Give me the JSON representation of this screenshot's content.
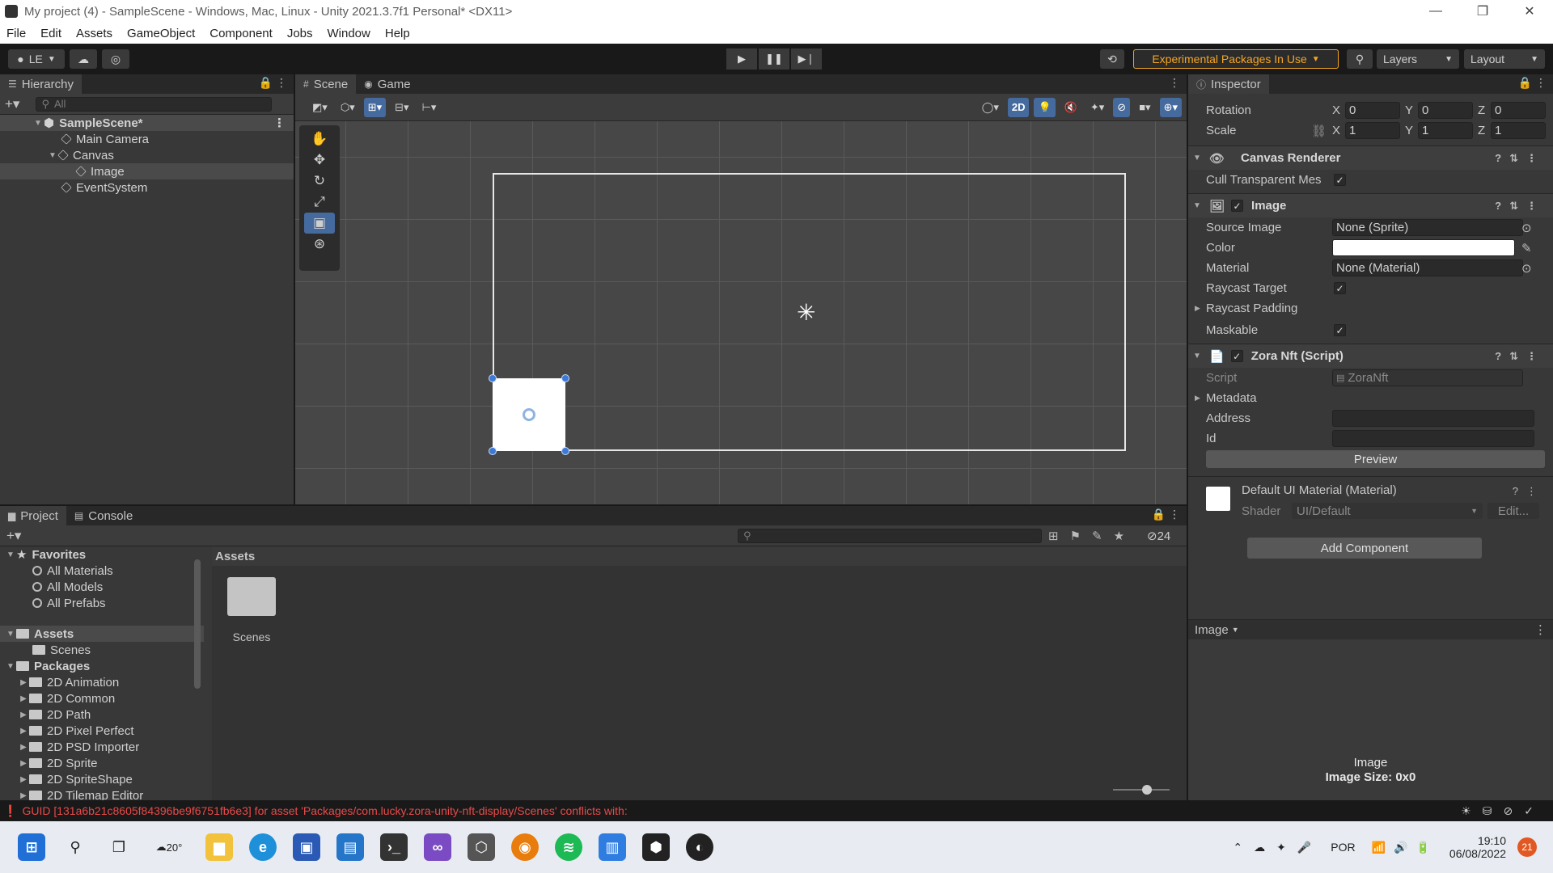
{
  "window": {
    "title": "My project (4) - SampleScene - Windows, Mac, Linux - Unity 2021.3.7f1 Personal* <DX11>",
    "minimize": "—",
    "restore": "❐",
    "close": "✕"
  },
  "menu": [
    "File",
    "Edit",
    "Assets",
    "GameObject",
    "Component",
    "Jobs",
    "Window",
    "Help"
  ],
  "toolbar": {
    "account": "LE",
    "experimental": "Experimental Packages In Use",
    "layers": "Layers",
    "layout": "Layout"
  },
  "hierarchy": {
    "tab": "Hierarchy",
    "search_placeholder": "All",
    "items": [
      "SampleScene*",
      "Main Camera",
      "Canvas",
      "Image",
      "EventSystem"
    ]
  },
  "scene": {
    "tabs": [
      "Scene",
      "Game"
    ],
    "mode_2d": "2D"
  },
  "inspector": {
    "tab": "Inspector",
    "transform": {
      "rotation_label": "Rotation",
      "scale_label": "Scale",
      "rotation": [
        "0",
        "0",
        "0"
      ],
      "scale": [
        "1",
        "1",
        "1"
      ],
      "axes": [
        "X",
        "Y",
        "Z"
      ]
    },
    "canvas_renderer": {
      "title": "Canvas Renderer",
      "cull_label": "Cull Transparent Mes"
    },
    "image": {
      "title": "Image",
      "source_image_label": "Source Image",
      "source_image": "None (Sprite)",
      "color_label": "Color",
      "material_label": "Material",
      "material": "None (Material)",
      "raycast_target_label": "Raycast Target",
      "raycast_padding_label": "Raycast Padding",
      "maskable_label": "Maskable"
    },
    "zora": {
      "title": "Zora Nft (Script)",
      "script_label": "Script",
      "script": "ZoraNft",
      "metadata_label": "Metadata",
      "address_label": "Address",
      "id_label": "Id",
      "preview_button": "Preview"
    },
    "material": {
      "title": "Default UI Material (Material)",
      "shader_label": "Shader",
      "shader": "UI/Default",
      "edit_button": "Edit..."
    },
    "add_component": "Add Component",
    "preview_header": "Image",
    "preview_name": "Image",
    "preview_size": "Image Size: 0x0"
  },
  "project": {
    "tabs": [
      "Project",
      "Console"
    ],
    "favorites_label": "Favorites",
    "favorites": [
      "All Materials",
      "All Models",
      "All Prefabs"
    ],
    "assets_label": "Assets",
    "assets_children": [
      "Scenes"
    ],
    "packages_label": "Packages",
    "packages": [
      "2D Animation",
      "2D Common",
      "2D Path",
      "2D Pixel Perfect",
      "2D PSD Importer",
      "2D Sprite",
      "2D SpriteShape",
      "2D Tilemap Editor"
    ],
    "breadcrumb": "Assets",
    "grid_items": [
      "Scenes"
    ],
    "hidden_count": "24"
  },
  "status": {
    "error": "GUID [131a6b21c8605f84396be9f6751fb6e3] for asset 'Packages/com.lucky.zora-unity-nft-display/Scenes' conflicts with:"
  },
  "taskbar": {
    "weather": "20°",
    "language": "POR",
    "time": "19:10",
    "date": "06/08/2022",
    "notifications": "21"
  },
  "colors": {
    "accent": "#456a9e",
    "experimental": "#f5a623",
    "error": "#e84a4a"
  }
}
